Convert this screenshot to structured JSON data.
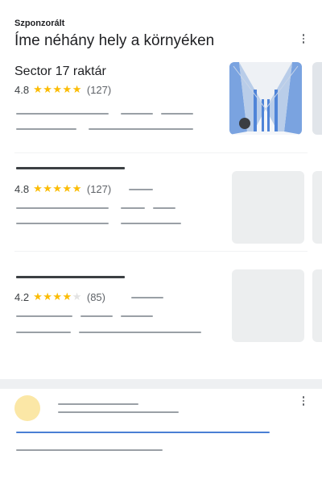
{
  "sponsored_card": {
    "label": "Szponzorált",
    "title": "Íme néhány hely a környéken",
    "menu_icon": "more-vert-icon",
    "places": [
      {
        "name": "Sector 17 raktár",
        "rating": "4.8",
        "stars": "★★★★★",
        "stars_empty": "",
        "review_count": "(127)",
        "thumbnail": "warehouse-photo"
      },
      {
        "name": "",
        "rating": "4.8",
        "stars": "★★★★★",
        "stars_empty": "",
        "review_count": "(127)",
        "thumbnail": "image-placeholder"
      },
      {
        "name": "",
        "rating": "4.2",
        "stars": "★★★★",
        "stars_empty": "★",
        "review_count": "(85)",
        "thumbnail": "image-placeholder"
      }
    ]
  },
  "next_card": {
    "menu_icon": "more-vert-icon",
    "avatar": "avatar-placeholder"
  },
  "colors": {
    "star": "#fbbc04",
    "skeleton_line": "#9aa0a6",
    "link_line": "#4a7fd4",
    "avatar": "#fbe7a6"
  }
}
